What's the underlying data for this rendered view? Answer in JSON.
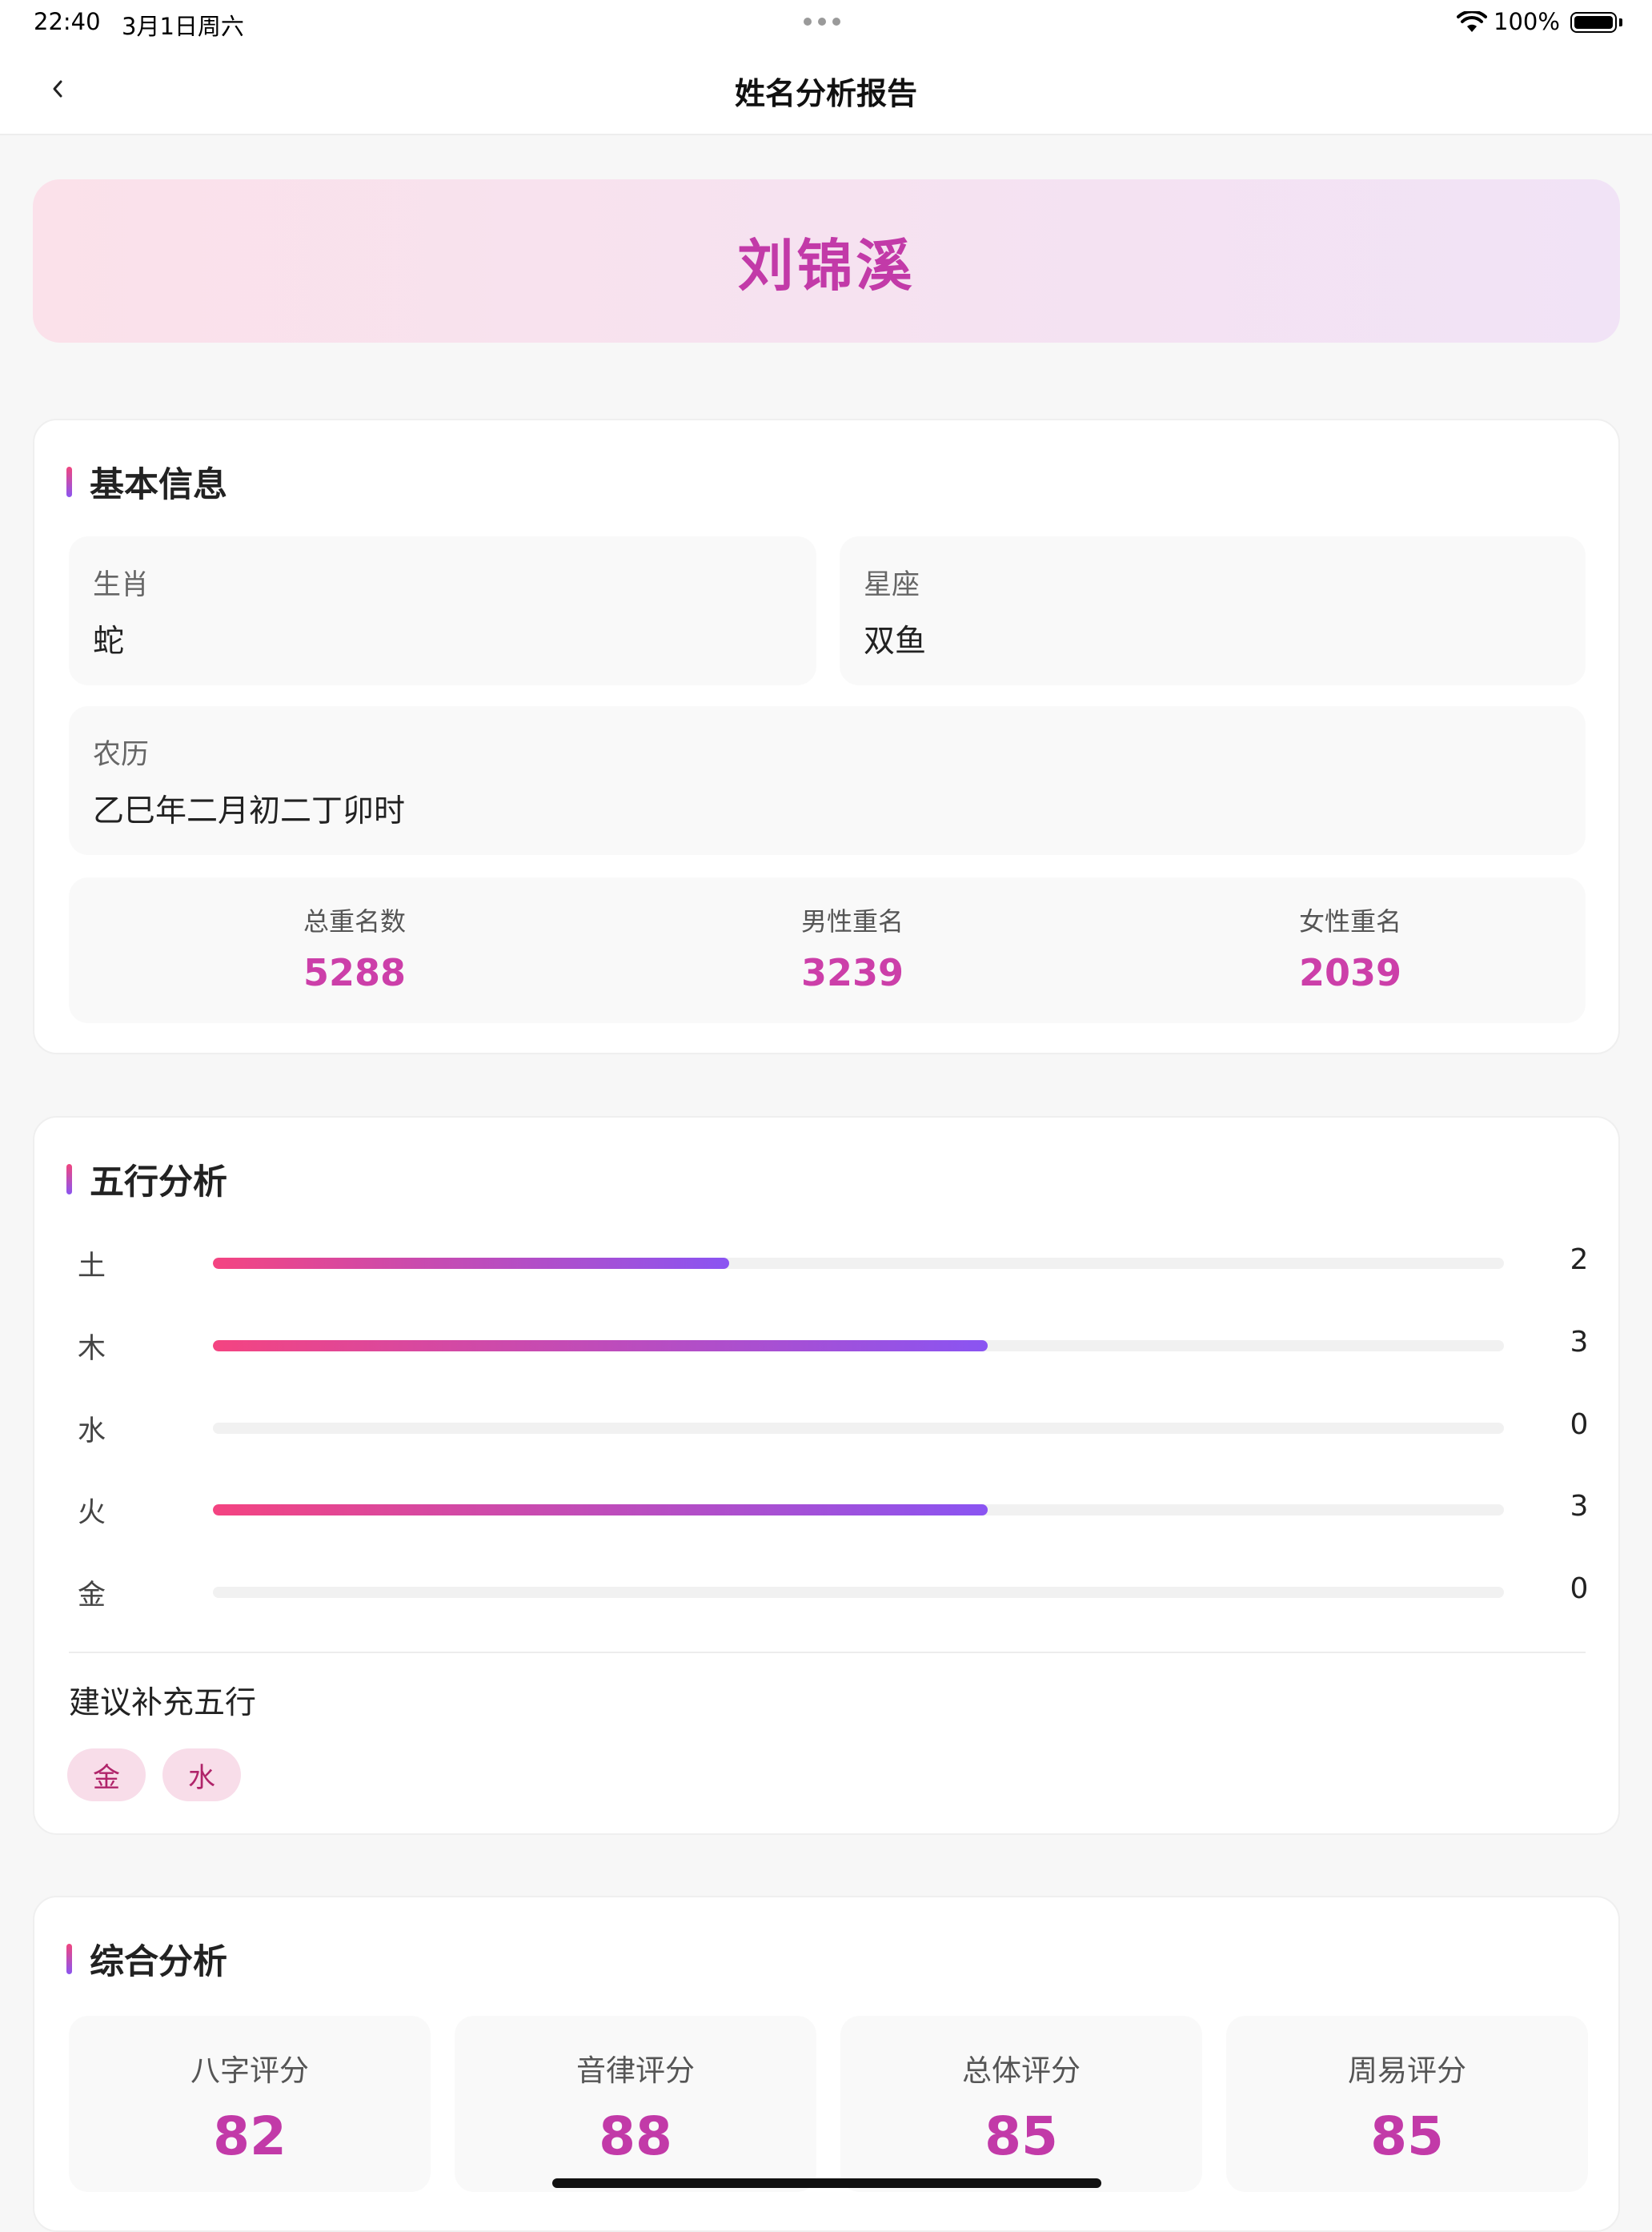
{
  "status": {
    "time": "22:40",
    "date": "3月1日周六",
    "battery": "100%"
  },
  "nav": {
    "back_icon": "chevron-left-icon",
    "title": "姓名分析报告"
  },
  "hero": {
    "name": "刘锦溪"
  },
  "basic": {
    "title": "基本信息",
    "zodiac_label": "生肖",
    "zodiac_value": "蛇",
    "constellation_label": "星座",
    "constellation_value": "双鱼",
    "lunar_label": "农历",
    "lunar_value": "乙巳年二月初二丁卯时",
    "stats": [
      {
        "label": "总重名数",
        "value": "5288"
      },
      {
        "label": "男性重名",
        "value": "3239"
      },
      {
        "label": "女性重名",
        "value": "2039"
      }
    ]
  },
  "wuxing": {
    "title": "五行分析",
    "max": 5,
    "items": [
      {
        "label": "土",
        "value": 2,
        "display": "2"
      },
      {
        "label": "木",
        "value": 3,
        "display": "3"
      },
      {
        "label": "水",
        "value": 0,
        "display": "0"
      },
      {
        "label": "火",
        "value": 3,
        "display": "3"
      },
      {
        "label": "金",
        "value": 0,
        "display": "0"
      }
    ],
    "suggest_title": "建议补充五行",
    "suggest_tags": [
      "金",
      "水"
    ]
  },
  "comprehensive": {
    "title": "综合分析",
    "scores": [
      {
        "label": "八字评分",
        "value": "82"
      },
      {
        "label": "音律评分",
        "value": "88"
      },
      {
        "label": "总体评分",
        "value": "85"
      },
      {
        "label": "周易评分",
        "value": "85"
      }
    ]
  },
  "colors": {
    "accent": "#c23aa8",
    "gradient_start": "#f44481",
    "gradient_end": "#8a54f2"
  }
}
